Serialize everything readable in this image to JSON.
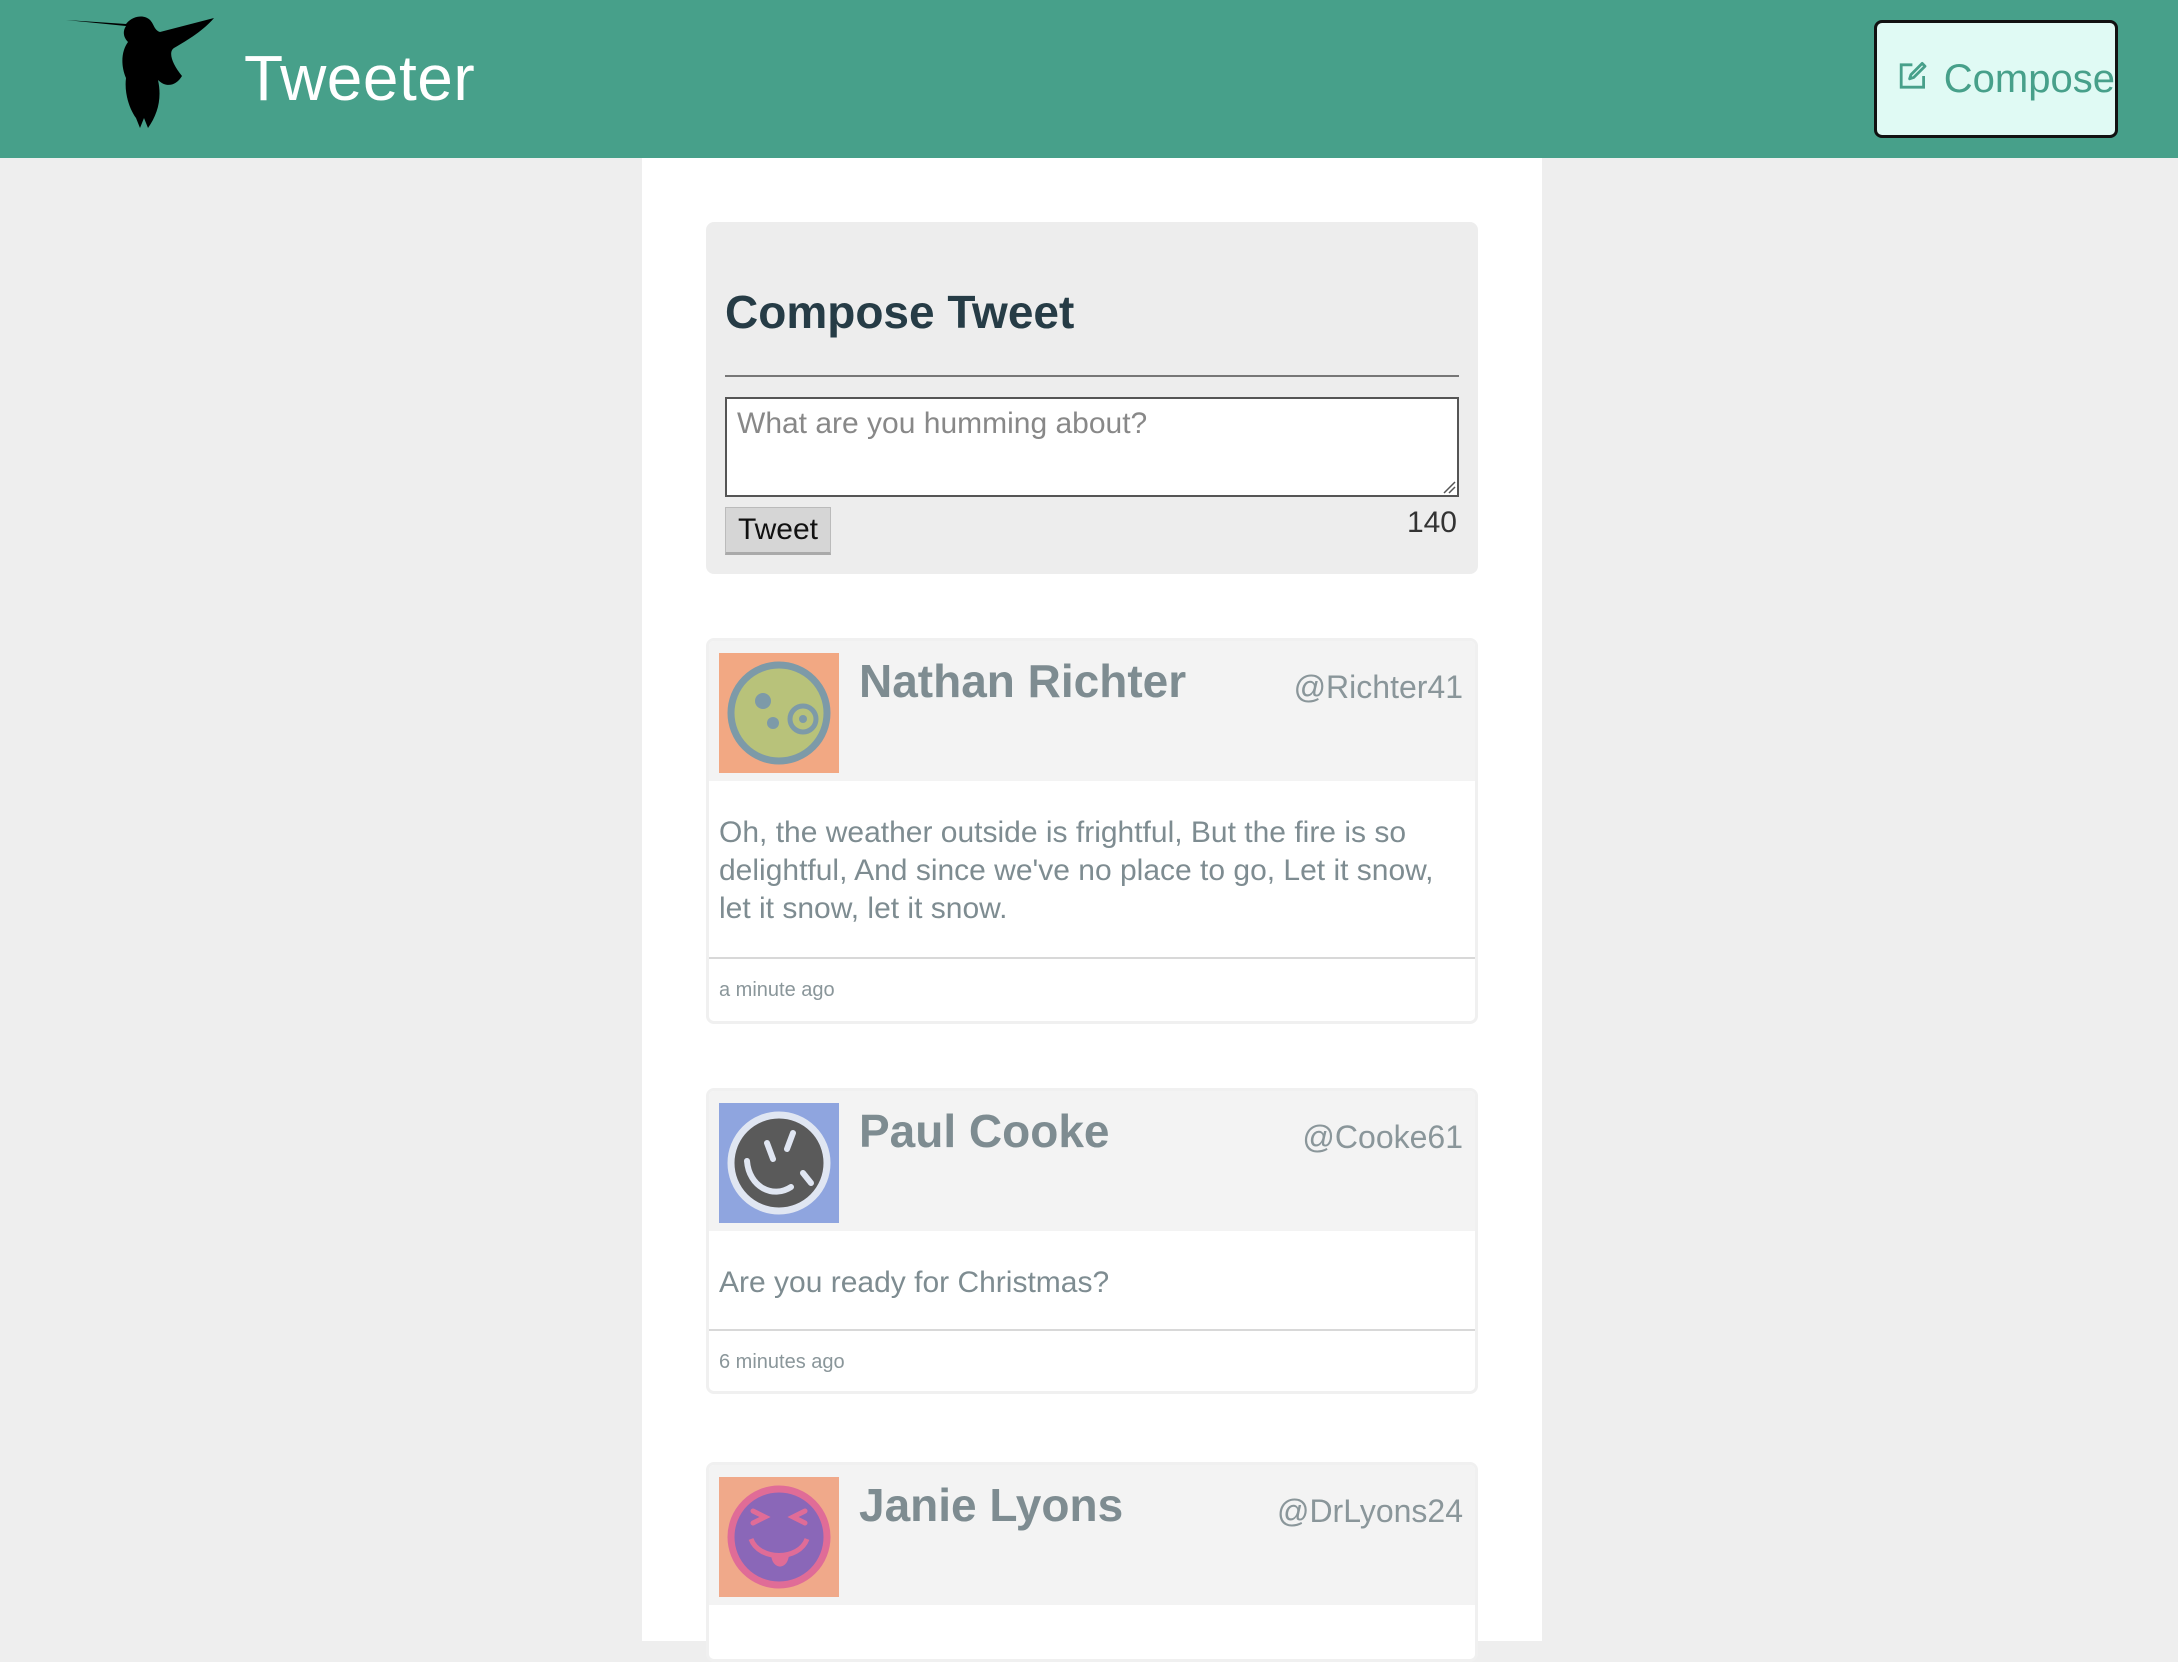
{
  "header": {
    "brand": "Tweeter",
    "compose_label": "Compose"
  },
  "compose": {
    "title": "Compose Tweet",
    "placeholder": "What are you humming about?",
    "tweet_button": "Tweet",
    "counter": "140"
  },
  "tweets": [
    {
      "name": "Nathan Richter",
      "handle": "@Richter41",
      "text": "Oh, the weather outside is frightful, But the fire is so delightful, And since we've no place to go, Let it snow, let it snow, let it snow.",
      "time": "a minute ago",
      "avatar_bg": "#f2a883",
      "avatar_face": "#b8c27a",
      "avatar_ring": "#7d9aa8"
    },
    {
      "name": "Paul Cooke",
      "handle": "@Cooke61",
      "text": "Are you ready for Christmas?",
      "time": "6 minutes ago",
      "avatar_bg": "#8fa5df",
      "avatar_face": "#5a5a5a",
      "avatar_ring": "#e0e6f2"
    },
    {
      "name": "Janie Lyons",
      "handle": "@DrLyons24",
      "text": "",
      "time": "",
      "avatar_bg": "#f0a98a",
      "avatar_face": "#8a67b8",
      "avatar_ring": "#e06c97"
    }
  ],
  "colors": {
    "accent": "#47a08a",
    "compose_button_bg": "#e0faf4"
  }
}
